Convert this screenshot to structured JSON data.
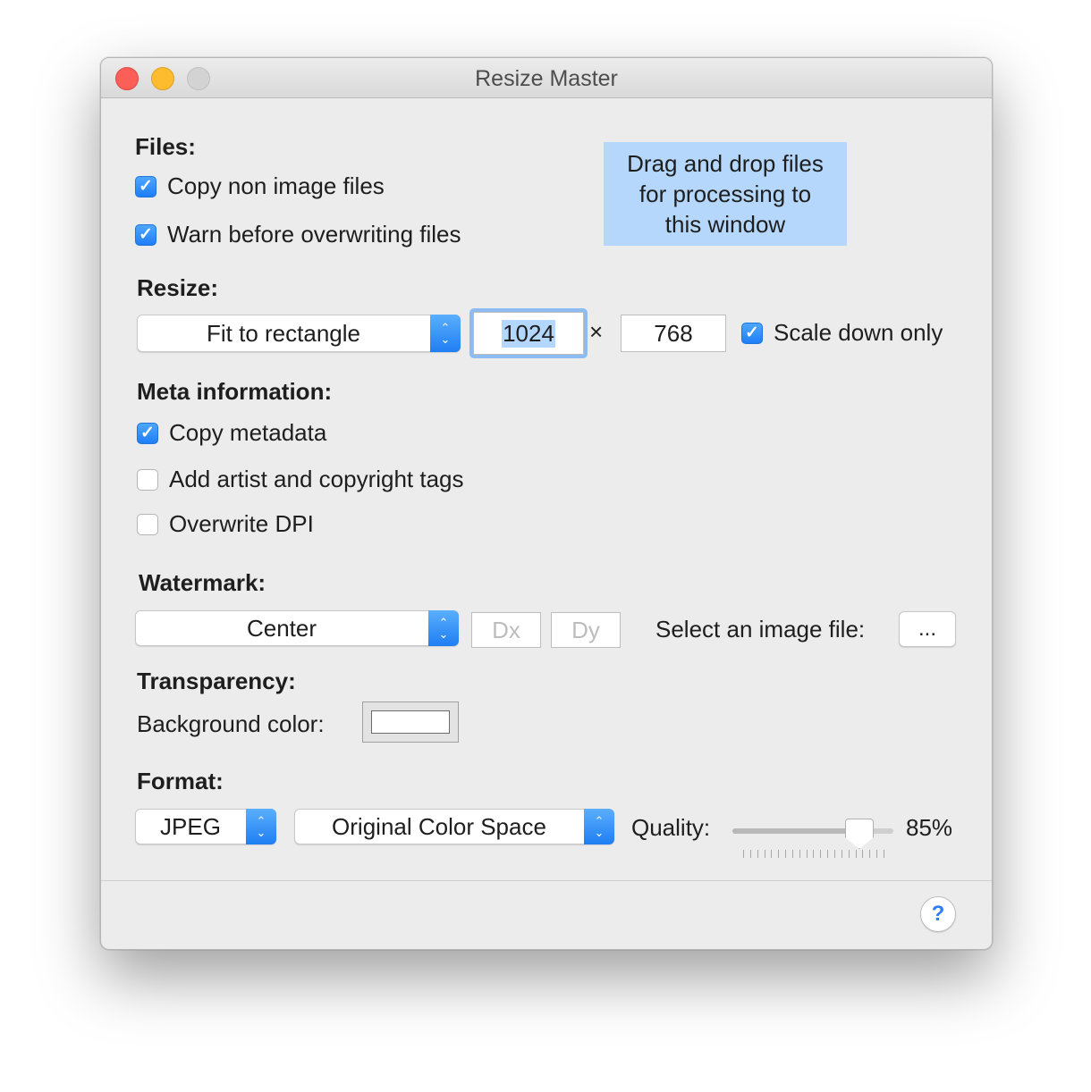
{
  "window": {
    "title": "Resize Master"
  },
  "dropzone": {
    "lines": [
      "Drag and drop files",
      "for processing to",
      "this window"
    ]
  },
  "files": {
    "heading": "Files:",
    "copy_non_image": {
      "label": "Copy non image files",
      "checked": true
    },
    "warn_overwrite": {
      "label": "Warn before overwriting files",
      "checked": true
    }
  },
  "resize": {
    "heading": "Resize:",
    "mode": "Fit to rectangle",
    "width": "1024",
    "times": "×",
    "height": "768",
    "scale_down_only": {
      "label": "Scale down only",
      "checked": true
    }
  },
  "meta": {
    "heading": "Meta information:",
    "copy_metadata": {
      "label": "Copy metadata",
      "checked": true
    },
    "artist_copyright": {
      "label": "Add artist and copyright tags",
      "checked": false
    },
    "overwrite_dpi": {
      "label": "Overwrite DPI",
      "checked": false
    }
  },
  "watermark": {
    "heading": "Watermark:",
    "position": "Center",
    "dx_placeholder": "Dx",
    "dy_placeholder": "Dy",
    "select_label": "Select an image file:",
    "browse_label": "..."
  },
  "transparency": {
    "heading": "Transparency:",
    "background_label": "Background color:",
    "background_color": "#ffffff"
  },
  "format": {
    "heading": "Format:",
    "type": "JPEG",
    "color_space": "Original Color Space",
    "quality_label": "Quality:",
    "quality_value": "85%",
    "quality_fraction": 0.85
  },
  "help": {
    "label": "?"
  },
  "colors": {
    "accent": "#1e7ef5",
    "dropzone": "#b4d7fb",
    "selection": "#b3d7ff"
  },
  "icons": {
    "checkmark": "✓",
    "popup_arrows": "up-down-chevron-icon",
    "close": "close-button-red",
    "minimize": "minimize-button-yellow",
    "zoom": "zoom-button-gray"
  }
}
